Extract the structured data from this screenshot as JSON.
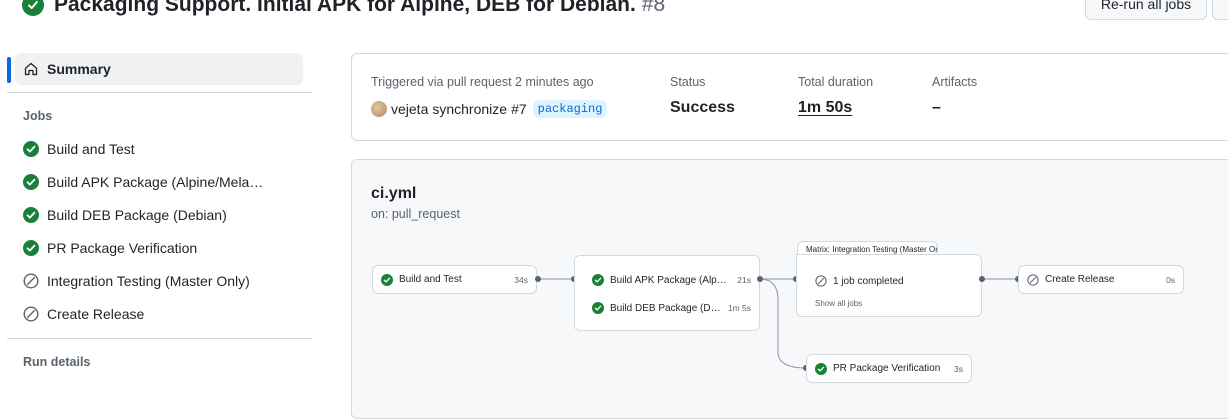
{
  "header": {
    "title": "Packaging Support. Initial APK for Alpine, DEB for Debian.",
    "run_number": "#8",
    "rerun_label": "Re-run all jobs"
  },
  "sidebar": {
    "summary_label": "Summary",
    "jobs_heading": "Jobs",
    "jobs": [
      {
        "label": "Build and Test",
        "status": "success"
      },
      {
        "label": "Build APK Package (Alpine/Melange)",
        "status": "success"
      },
      {
        "label": "Build DEB Package (Debian)",
        "status": "success"
      },
      {
        "label": "PR Package Verification",
        "status": "success"
      },
      {
        "label": "Integration Testing (Master Only)",
        "status": "skipped"
      },
      {
        "label": "Create Release",
        "status": "skipped"
      }
    ],
    "run_details_heading": "Run details"
  },
  "summary": {
    "trigger_label": "Triggered via pull request 2 minutes ago",
    "actor": "vejeta",
    "action": "synchronize",
    "pr": "#7",
    "branch": "packaging",
    "status_label": "Status",
    "status_value": "Success",
    "duration_label": "Total duration",
    "duration_value": "1m 50s",
    "artifacts_label": "Artifacts",
    "artifacts_value": "–"
  },
  "workflow": {
    "file": "ci.yml",
    "trigger": "on: pull_request",
    "nodes": {
      "build_test": {
        "name": "Build and Test",
        "time": "34s"
      },
      "build_apk": {
        "name": "Build APK Package (Alpine/Melange)",
        "time": "21s"
      },
      "build_deb": {
        "name": "Build DEB Package (Debian)",
        "time": "1m 5s"
      },
      "matrix_title": "Matrix: Integration Testing (Master Only)",
      "matrix_summary": "1 job completed",
      "matrix_link": "Show all jobs",
      "create_release": {
        "name": "Create Release",
        "time": "0s"
      },
      "pr_verify": {
        "name": "PR Package Verification",
        "time": "3s"
      }
    }
  },
  "colors": {
    "success": "#1a7f37",
    "skipped": "#59636e",
    "accent": "#0969da",
    "border": "#d1d9e0"
  }
}
